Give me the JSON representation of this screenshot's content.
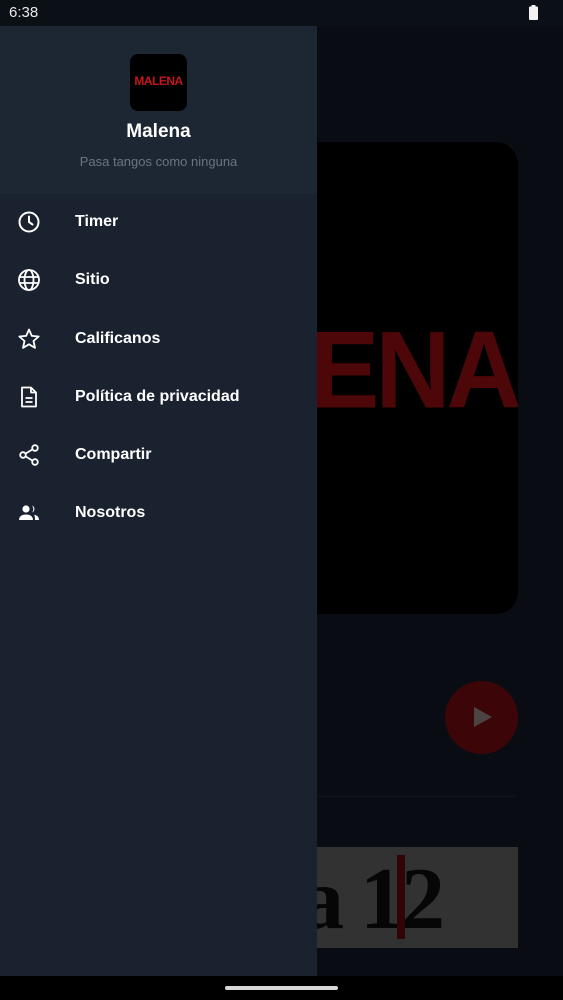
{
  "status_bar": {
    "time": "6:38",
    "battery_icon": "battery-full-icon"
  },
  "background": {
    "artwork_text": "ENA",
    "banner_text": "a 12",
    "play_icon": "play-icon",
    "accent_color": "#8c0e10"
  },
  "drawer": {
    "logo_text": "MALENA",
    "app_name": "Malena",
    "tagline": "Pasa tangos como ninguna",
    "items": [
      {
        "label": "Timer",
        "icon": "clock-icon"
      },
      {
        "label": "Sitio",
        "icon": "globe-icon"
      },
      {
        "label": "Calificanos",
        "icon": "star-icon"
      },
      {
        "label": "Política de privacidad",
        "icon": "document-icon"
      },
      {
        "label": "Compartir",
        "icon": "share-icon"
      },
      {
        "label": "Nosotros",
        "icon": "people-icon"
      }
    ]
  },
  "colors": {
    "drawer_bg": "#1a2230",
    "logo_red": "#c4161c"
  }
}
